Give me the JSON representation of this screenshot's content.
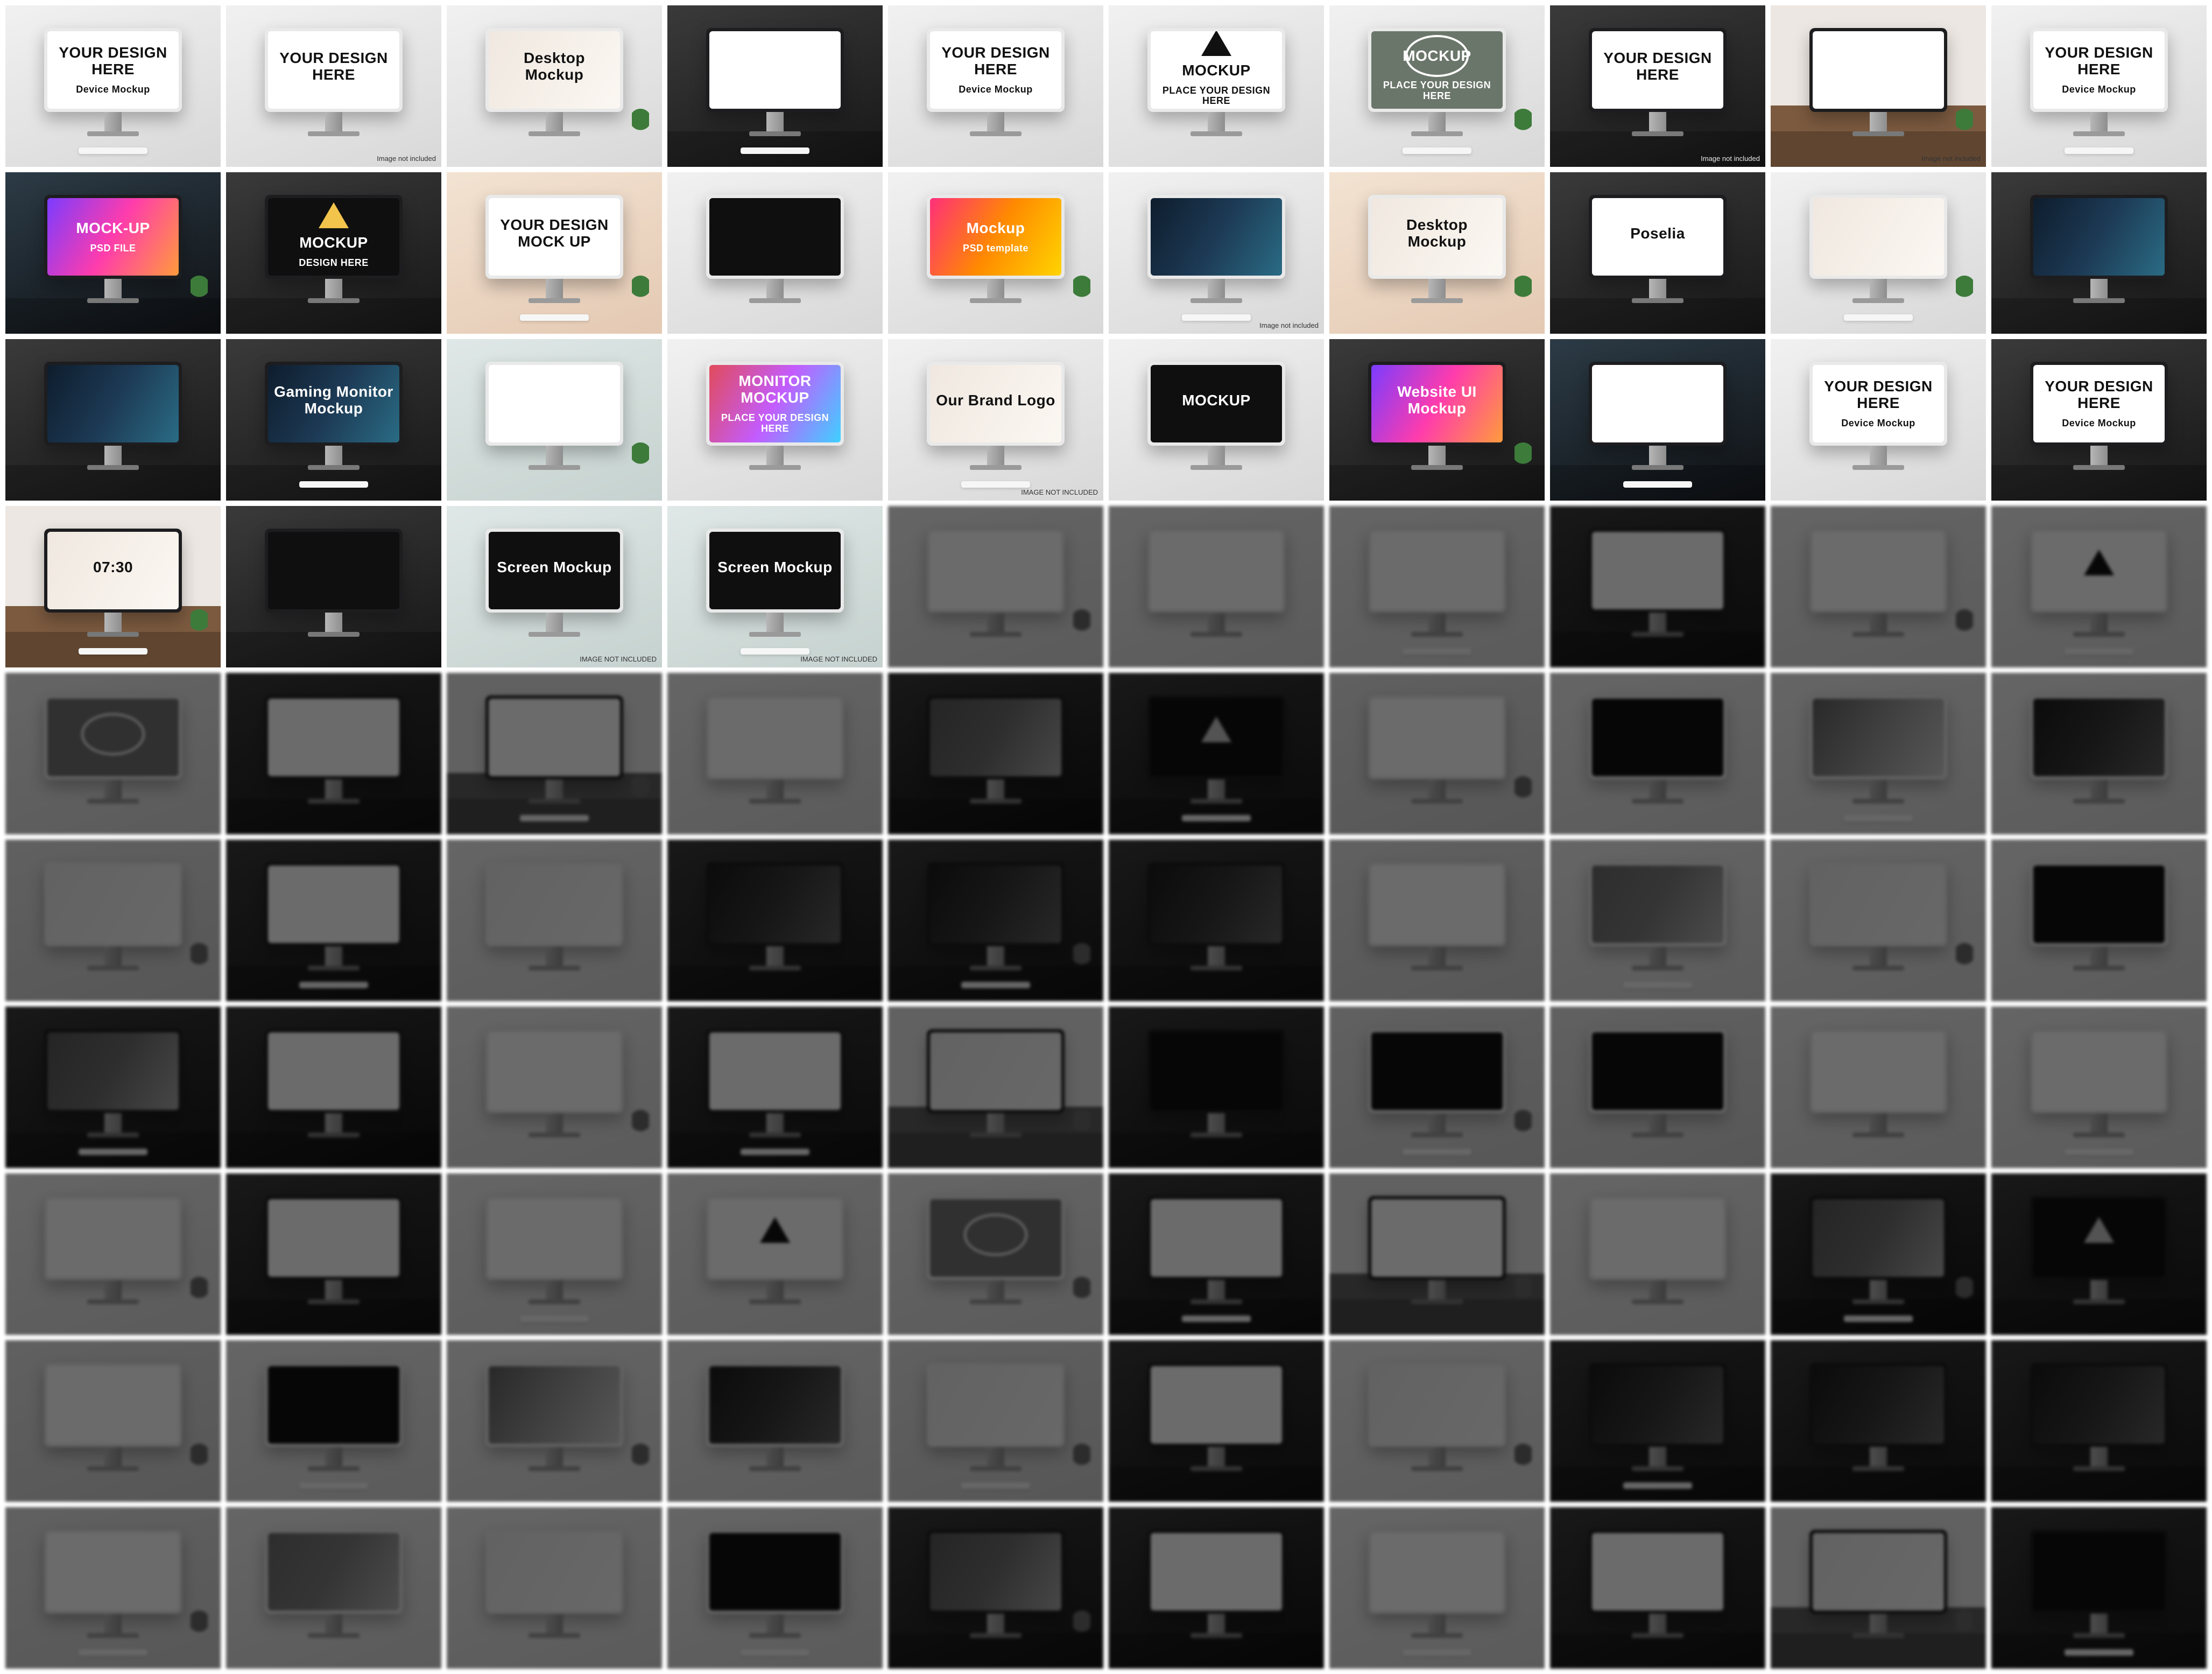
{
  "tiles": [
    {
      "title": "YOUR DESIGN HERE",
      "subtitle": "Device Mockup",
      "style": "studio",
      "screen": "white",
      "note": ""
    },
    {
      "title": "YOUR DESIGN HERE",
      "subtitle": "",
      "style": "studio",
      "screen": "white",
      "note": "Image not included"
    },
    {
      "title": "Desktop Mockup",
      "subtitle": "",
      "style": "studio",
      "screen": "pk",
      "note": ""
    },
    {
      "title": "",
      "subtitle": "",
      "style": "dark",
      "screen": "white",
      "note": ""
    },
    {
      "title": "YOUR DESIGN HERE",
      "subtitle": "Device Mockup",
      "style": "studio",
      "screen": "white",
      "note": ""
    },
    {
      "title": "MOCKUP",
      "subtitle": "PLACE YOUR DESIGN HERE",
      "style": "studio",
      "screen": "tri",
      "note": ""
    },
    {
      "title": "MOCKUP",
      "subtitle": "PLACE YOUR DESIGN HERE",
      "style": "studio",
      "screen": "ring",
      "note": ""
    },
    {
      "title": "YOUR DESIGN HERE",
      "subtitle": "",
      "style": "dark",
      "screen": "white",
      "note": "Image not included"
    },
    {
      "title": "",
      "subtitle": "",
      "style": "wood",
      "screen": "white",
      "note": "Image not included"
    },
    {
      "title": "YOUR DESIGN HERE",
      "subtitle": "Device Mockup",
      "style": "studio",
      "screen": "white",
      "note": ""
    },
    {
      "title": "MOCK-UP",
      "subtitle": "PSD FILE",
      "style": "night",
      "screen": "g2",
      "note": ""
    },
    {
      "title": "MOCKUP",
      "subtitle": "DESIGN HERE",
      "style": "dark",
      "screen": "tri-dk",
      "note": ""
    },
    {
      "title": "YOUR DESIGN MOCK UP",
      "subtitle": "",
      "style": "warm",
      "screen": "white",
      "note": ""
    },
    {
      "title": "",
      "subtitle": "",
      "style": "studio",
      "screen": "dk",
      "note": ""
    },
    {
      "title": "Mockup",
      "subtitle": "PSD template",
      "style": "studio",
      "screen": "g1",
      "note": ""
    },
    {
      "title": "",
      "subtitle": "",
      "style": "studio",
      "screen": "g3",
      "note": "Image not included"
    },
    {
      "title": "Desktop Mockup",
      "subtitle": "",
      "style": "warm",
      "screen": "pk",
      "note": ""
    },
    {
      "title": "Poselia",
      "subtitle": "",
      "style": "dark",
      "screen": "white",
      "note": ""
    },
    {
      "title": "",
      "subtitle": "",
      "style": "studio",
      "screen": "pk",
      "note": ""
    },
    {
      "title": "",
      "subtitle": "",
      "style": "dark",
      "screen": "g3",
      "note": ""
    },
    {
      "title": "",
      "subtitle": "",
      "style": "dark",
      "screen": "g3",
      "note": ""
    },
    {
      "title": "Gaming Monitor Mockup",
      "subtitle": "",
      "style": "dark",
      "screen": "g3",
      "note": ""
    },
    {
      "title": "",
      "subtitle": "",
      "style": "teal",
      "screen": "white",
      "note": ""
    },
    {
      "title": "MONITOR MOCKUP",
      "subtitle": "PLACE YOUR DESIGN HERE",
      "style": "studio",
      "screen": "g4",
      "note": ""
    },
    {
      "title": "Our Brand Logo",
      "subtitle": "",
      "style": "studio",
      "screen": "pk",
      "note": "IMAGE NOT INCLUDED"
    },
    {
      "title": "MOCKUP",
      "subtitle": "",
      "style": "studio",
      "screen": "dk",
      "note": ""
    },
    {
      "title": "Website UI Mockup",
      "subtitle": "",
      "style": "dark",
      "screen": "g2",
      "note": ""
    },
    {
      "title": "",
      "subtitle": "",
      "style": "night",
      "screen": "white",
      "note": ""
    },
    {
      "title": "YOUR DESIGN HERE",
      "subtitle": "Device Mockup",
      "style": "studio",
      "screen": "white",
      "note": ""
    },
    {
      "title": "YOUR DESIGN HERE",
      "subtitle": "Device Mockup",
      "style": "dark",
      "screen": "white",
      "note": ""
    },
    {
      "title": "07:30",
      "subtitle": "",
      "style": "wood",
      "screen": "pk",
      "note": ""
    },
    {
      "title": "",
      "subtitle": "",
      "style": "dark",
      "screen": "dk",
      "note": ""
    },
    {
      "title": "Screen Mockup",
      "subtitle": "",
      "style": "teal",
      "screen": "dk",
      "note": "IMAGE NOT INCLUDED"
    },
    {
      "title": "Screen Mockup",
      "subtitle": "",
      "style": "teal",
      "screen": "dk",
      "note": "IMAGE NOT INCLUDED"
    },
    {
      "title": "",
      "subtitle": "",
      "style": "studio",
      "screen": "white",
      "dim": true,
      "note": ""
    },
    {
      "title": "",
      "subtitle": "",
      "style": "studio",
      "screen": "white",
      "dim": true,
      "note": ""
    },
    {
      "title": "",
      "subtitle": "",
      "style": "studio",
      "screen": "white",
      "dim": true,
      "note": ""
    },
    {
      "title": "",
      "subtitle": "",
      "style": "dark",
      "screen": "white",
      "dim": true,
      "note": ""
    },
    {
      "title": "",
      "subtitle": "",
      "style": "studio",
      "screen": "white",
      "dim": true,
      "note": ""
    },
    {
      "title": "",
      "subtitle": "",
      "style": "studio",
      "screen": "tri",
      "dim": true,
      "note": ""
    },
    {
      "title": "",
      "subtitle": "",
      "style": "studio",
      "screen": "ring",
      "dim": true,
      "note": ""
    },
    {
      "title": "",
      "subtitle": "",
      "style": "dark",
      "screen": "white",
      "dim": true,
      "note": ""
    },
    {
      "title": "",
      "subtitle": "",
      "style": "wood",
      "screen": "white",
      "dim": true,
      "note": ""
    },
    {
      "title": "",
      "subtitle": "",
      "style": "studio",
      "screen": "white",
      "dim": true,
      "note": ""
    },
    {
      "title": "",
      "subtitle": "",
      "style": "night",
      "screen": "g2",
      "dim": true,
      "note": ""
    },
    {
      "title": "",
      "subtitle": "",
      "style": "dark",
      "screen": "tri-dk",
      "dim": true,
      "note": ""
    },
    {
      "title": "",
      "subtitle": "",
      "style": "warm",
      "screen": "white",
      "dim": true,
      "note": ""
    },
    {
      "title": "",
      "subtitle": "",
      "style": "studio",
      "screen": "dk",
      "dim": true,
      "note": ""
    },
    {
      "title": "",
      "subtitle": "",
      "style": "studio",
      "screen": "g1",
      "dim": true,
      "note": ""
    },
    {
      "title": "",
      "subtitle": "",
      "style": "studio",
      "screen": "g3",
      "dim": true,
      "note": ""
    },
    {
      "title": "",
      "subtitle": "",
      "style": "warm",
      "screen": "pk",
      "dim": true,
      "note": ""
    },
    {
      "title": "",
      "subtitle": "",
      "style": "dark",
      "screen": "white",
      "dim": true,
      "note": ""
    },
    {
      "title": "",
      "subtitle": "",
      "style": "studio",
      "screen": "pk",
      "dim": true,
      "note": ""
    },
    {
      "title": "",
      "subtitle": "",
      "style": "dark",
      "screen": "g3",
      "dim": true,
      "note": ""
    },
    {
      "title": "",
      "subtitle": "",
      "style": "dark",
      "screen": "g3",
      "dim": true,
      "note": ""
    },
    {
      "title": "",
      "subtitle": "",
      "style": "dark",
      "screen": "g3",
      "dim": true,
      "note": ""
    },
    {
      "title": "",
      "subtitle": "",
      "style": "teal",
      "screen": "white",
      "dim": true,
      "note": ""
    },
    {
      "title": "",
      "subtitle": "",
      "style": "studio",
      "screen": "g4",
      "dim": true,
      "note": ""
    },
    {
      "title": "",
      "subtitle": "",
      "style": "studio",
      "screen": "pk",
      "dim": true,
      "note": ""
    },
    {
      "title": "",
      "subtitle": "",
      "style": "studio",
      "screen": "dk",
      "dim": true,
      "note": ""
    },
    {
      "title": "",
      "subtitle": "",
      "style": "dark",
      "screen": "g2",
      "dim": true,
      "note": ""
    },
    {
      "title": "",
      "subtitle": "",
      "style": "night",
      "screen": "white",
      "dim": true,
      "note": ""
    },
    {
      "title": "",
      "subtitle": "",
      "style": "studio",
      "screen": "white",
      "dim": true,
      "note": ""
    },
    {
      "title": "",
      "subtitle": "",
      "style": "dark",
      "screen": "white",
      "dim": true,
      "note": ""
    },
    {
      "title": "",
      "subtitle": "",
      "style": "wood",
      "screen": "pk",
      "dim": true,
      "note": ""
    },
    {
      "title": "",
      "subtitle": "",
      "style": "dark",
      "screen": "dk",
      "dim": true,
      "note": ""
    },
    {
      "title": "",
      "subtitle": "",
      "style": "teal",
      "screen": "dk",
      "dim": true,
      "note": ""
    },
    {
      "title": "",
      "subtitle": "",
      "style": "teal",
      "screen": "dk",
      "dim": true,
      "note": ""
    },
    {
      "title": "",
      "subtitle": "",
      "style": "studio",
      "screen": "white",
      "dim": true,
      "note": ""
    },
    {
      "title": "",
      "subtitle": "",
      "style": "studio",
      "screen": "white",
      "dim": true,
      "note": ""
    },
    {
      "title": "",
      "subtitle": "",
      "style": "studio",
      "screen": "white",
      "dim": true,
      "note": ""
    },
    {
      "title": "",
      "subtitle": "",
      "style": "dark",
      "screen": "white",
      "dim": true,
      "note": ""
    },
    {
      "title": "",
      "subtitle": "",
      "style": "studio",
      "screen": "white",
      "dim": true,
      "note": ""
    },
    {
      "title": "",
      "subtitle": "",
      "style": "studio",
      "screen": "tri",
      "dim": true,
      "note": ""
    },
    {
      "title": "",
      "subtitle": "",
      "style": "studio",
      "screen": "ring",
      "dim": true,
      "note": ""
    },
    {
      "title": "",
      "subtitle": "",
      "style": "dark",
      "screen": "white",
      "dim": true,
      "note": ""
    },
    {
      "title": "",
      "subtitle": "",
      "style": "wood",
      "screen": "white",
      "dim": true,
      "note": ""
    },
    {
      "title": "",
      "subtitle": "",
      "style": "studio",
      "screen": "white",
      "dim": true,
      "note": ""
    },
    {
      "title": "",
      "subtitle": "",
      "style": "night",
      "screen": "g2",
      "dim": true,
      "note": ""
    },
    {
      "title": "",
      "subtitle": "",
      "style": "dark",
      "screen": "tri-dk",
      "dim": true,
      "note": ""
    },
    {
      "title": "",
      "subtitle": "",
      "style": "warm",
      "screen": "white",
      "dim": true,
      "note": ""
    },
    {
      "title": "",
      "subtitle": "",
      "style": "studio",
      "screen": "dk",
      "dim": true,
      "note": ""
    },
    {
      "title": "",
      "subtitle": "",
      "style": "studio",
      "screen": "g1",
      "dim": true,
      "note": ""
    },
    {
      "title": "",
      "subtitle": "",
      "style": "studio",
      "screen": "g3",
      "dim": true,
      "note": ""
    },
    {
      "title": "",
      "subtitle": "",
      "style": "warm",
      "screen": "pk",
      "dim": true,
      "note": ""
    },
    {
      "title": "",
      "subtitle": "",
      "style": "dark",
      "screen": "white",
      "dim": true,
      "note": ""
    },
    {
      "title": "",
      "subtitle": "",
      "style": "studio",
      "screen": "pk",
      "dim": true,
      "note": ""
    },
    {
      "title": "",
      "subtitle": "",
      "style": "dark",
      "screen": "g3",
      "dim": true,
      "note": ""
    },
    {
      "title": "",
      "subtitle": "",
      "style": "dark",
      "screen": "g3",
      "dim": true,
      "note": ""
    },
    {
      "title": "",
      "subtitle": "",
      "style": "dark",
      "screen": "g3",
      "dim": true,
      "note": ""
    },
    {
      "title": "",
      "subtitle": "",
      "style": "teal",
      "screen": "white",
      "dim": true,
      "note": ""
    },
    {
      "title": "",
      "subtitle": "",
      "style": "studio",
      "screen": "g4",
      "dim": true,
      "note": ""
    },
    {
      "title": "",
      "subtitle": "",
      "style": "studio",
      "screen": "pk",
      "dim": true,
      "note": ""
    },
    {
      "title": "",
      "subtitle": "",
      "style": "studio",
      "screen": "dk",
      "dim": true,
      "note": ""
    },
    {
      "title": "",
      "subtitle": "",
      "style": "dark",
      "screen": "g2",
      "dim": true,
      "note": ""
    },
    {
      "title": "",
      "subtitle": "",
      "style": "night",
      "screen": "white",
      "dim": true,
      "note": ""
    },
    {
      "title": "",
      "subtitle": "",
      "style": "studio",
      "screen": "white",
      "dim": true,
      "note": ""
    },
    {
      "title": "",
      "subtitle": "",
      "style": "dark",
      "screen": "white",
      "dim": true,
      "note": ""
    },
    {
      "title": "",
      "subtitle": "",
      "style": "wood",
      "screen": "pk",
      "dim": true,
      "note": ""
    },
    {
      "title": "",
      "subtitle": "",
      "style": "dark",
      "screen": "dk",
      "dim": true,
      "note": ""
    }
  ]
}
